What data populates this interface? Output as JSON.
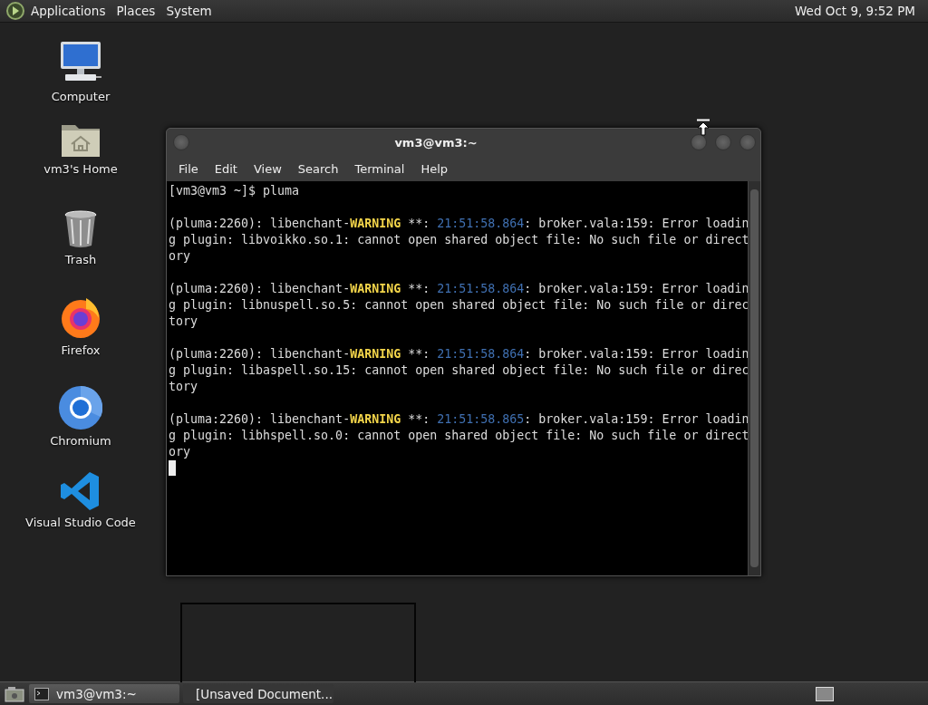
{
  "top_panel": {
    "menus": [
      "Applications",
      "Places",
      "System"
    ],
    "clock": "Wed Oct 9, 9:52 PM"
  },
  "desktop_icons": [
    {
      "kind": "computer",
      "label": "Computer"
    },
    {
      "kind": "home",
      "label": "vm3's Home"
    },
    {
      "kind": "trash",
      "label": "Trash"
    },
    {
      "kind": "firefox",
      "label": "Firefox"
    },
    {
      "kind": "chromium",
      "label": "Chromium"
    },
    {
      "kind": "vscode",
      "label": "Visual Studio Code"
    }
  ],
  "terminal": {
    "title": "vm3@vm3:~",
    "menu": [
      "File",
      "Edit",
      "View",
      "Search",
      "Terminal",
      "Help"
    ],
    "prompt": "[vm3@vm3 ~]$ pluma",
    "messages": [
      {
        "lines": [
          [
            {
              "kind": "plain",
              "text": "(pluma:2260): libenchant-"
            },
            {
              "kind": "warning",
              "text": "WARNING"
            },
            {
              "kind": "plain",
              "text": " **: "
            },
            {
              "kind": "time",
              "text": "21:51:58.864"
            },
            {
              "kind": "plain",
              "text": ": broker.vala:159: Error loadin"
            }
          ],
          [
            {
              "kind": "plain",
              "text": "g plugin: libvoikko.so.1: cannot open shared object file: No such file or direct"
            }
          ],
          [
            {
              "kind": "plain",
              "text": "ory"
            }
          ]
        ]
      },
      {
        "lines": [
          [
            {
              "kind": "plain",
              "text": "(pluma:2260): libenchant-"
            },
            {
              "kind": "warning",
              "text": "WARNING"
            },
            {
              "kind": "plain",
              "text": " **: "
            },
            {
              "kind": "time",
              "text": "21:51:58.864"
            },
            {
              "kind": "plain",
              "text": ": broker.vala:159: Error loadin"
            }
          ],
          [
            {
              "kind": "plain",
              "text": "g plugin: libnuspell.so.5: cannot open shared object file: No such file or direc"
            }
          ],
          [
            {
              "kind": "plain",
              "text": "tory"
            }
          ]
        ]
      },
      {
        "lines": [
          [
            {
              "kind": "plain",
              "text": "(pluma:2260): libenchant-"
            },
            {
              "kind": "warning",
              "text": "WARNING"
            },
            {
              "kind": "plain",
              "text": " **: "
            },
            {
              "kind": "time",
              "text": "21:51:58.864"
            },
            {
              "kind": "plain",
              "text": ": broker.vala:159: Error loadin"
            }
          ],
          [
            {
              "kind": "plain",
              "text": "g plugin: libaspell.so.15: cannot open shared object file: No such file or direc"
            }
          ],
          [
            {
              "kind": "plain",
              "text": "tory"
            }
          ]
        ]
      },
      {
        "lines": [
          [
            {
              "kind": "plain",
              "text": "(pluma:2260): libenchant-"
            },
            {
              "kind": "warning",
              "text": "WARNING"
            },
            {
              "kind": "plain",
              "text": " **: "
            },
            {
              "kind": "time",
              "text": "21:51:58.865"
            },
            {
              "kind": "plain",
              "text": ": broker.vala:159: Error loadin"
            }
          ],
          [
            {
              "kind": "plain",
              "text": "g plugin: libhspell.so.0: cannot open shared object file: No such file or direct"
            }
          ],
          [
            {
              "kind": "plain",
              "text": "ory"
            }
          ]
        ]
      }
    ]
  },
  "taskbar": {
    "items": [
      {
        "kind": "terminal",
        "label": "vm3@vm3:~",
        "selected": true
      },
      {
        "kind": "editor",
        "label": "[Unsaved Document...",
        "selected": false
      }
    ]
  }
}
